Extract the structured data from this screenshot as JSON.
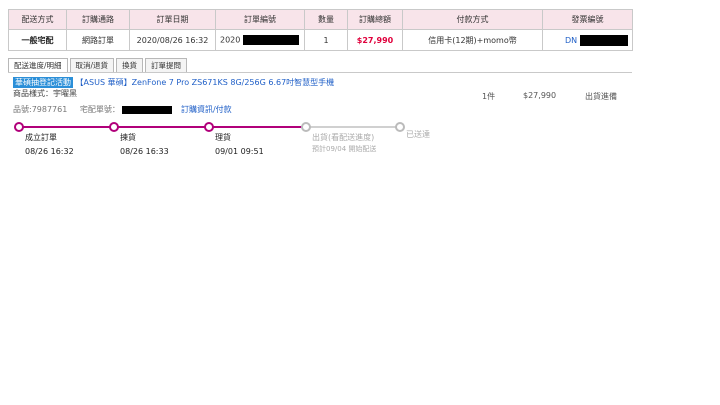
{
  "table": {
    "headers": [
      "配送方式",
      "訂購通路",
      "訂單日期",
      "訂單編號",
      "數量",
      "訂購總額",
      "付款方式",
      "發票編號"
    ],
    "row": {
      "shipping": "一般宅配",
      "channel": "網路訂單",
      "order_date": "2020/08/26 16:32",
      "order_no_prefix": "2020",
      "quantity": "1",
      "total": "$27,990",
      "payment": "信用卡(12期)+momo幣",
      "invoice_prefix": "DN"
    }
  },
  "tabs": [
    "配送進度/明細",
    "取消/退貨",
    "換貨",
    "訂單提問"
  ],
  "item": {
    "badge": "華碩抽登記活動",
    "name": "【ASUS 華碩】ZenFone 7 Pro ZS671KS 8G/256G 6.67吋智慧型手機",
    "spec": "商品樣式：宇曜黑",
    "product_no": "品號:7987761",
    "tracking_label": "宅配單號：",
    "order_info_link": "訂購資訊/付款",
    "qty": "1件",
    "amount": "$27,990",
    "ship_status": "出貨進備"
  },
  "progress": {
    "steps": [
      {
        "label": "成立訂單",
        "date": "08/26 16:32"
      },
      {
        "label": "揀貨",
        "date": "08/26 16:33"
      },
      {
        "label": "理貨",
        "date": "09/01 09:51"
      },
      {
        "label": "出貨(看配送進度)",
        "note": "預計09/04 開始配送"
      },
      {
        "label": "已送達"
      }
    ]
  }
}
